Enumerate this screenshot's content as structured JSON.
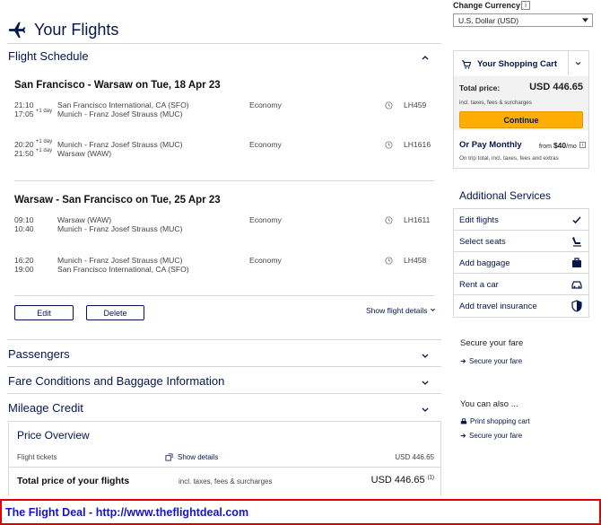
{
  "header": {
    "title": "Your Flights"
  },
  "schedule": {
    "title": "Flight Schedule",
    "routes": [
      {
        "title": "San Francisco - Warsaw on Tue, 18 Apr 23",
        "segments": [
          {
            "dep_time": "21:10",
            "dep_airport": "San Francisco International, CA (SFO)",
            "arr_time": "17:05",
            "arr_day": "+1 day",
            "arr_airport": "Munich - Franz Josef Strauss (MUC)",
            "cabin": "Economy",
            "flight": "LH459"
          },
          {
            "dep_time": "20:20",
            "dep_day": "+1 day",
            "dep_airport": "Munich - Franz Josef Strauss (MUC)",
            "arr_time": "21:50",
            "arr_day": "+1 day",
            "arr_airport": "Warsaw (WAW)",
            "cabin": "Economy",
            "flight": "LH1616"
          }
        ]
      },
      {
        "title": "Warsaw - San Francisco on Tue, 25 Apr 23",
        "segments": [
          {
            "dep_time": "09:10",
            "dep_airport": "Warsaw (WAW)",
            "arr_time": "10:40",
            "arr_airport": "Munich - Franz Josef Strauss (MUC)",
            "cabin": "Economy",
            "flight": "LH1611"
          },
          {
            "dep_time": "16:20",
            "dep_airport": "Munich - Franz Josef Strauss (MUC)",
            "arr_time": "19:00",
            "arr_airport": "San Francisco International, CA (SFO)",
            "cabin": "Economy",
            "flight": "LH458"
          }
        ]
      }
    ],
    "edit_label": "Edit",
    "delete_label": "Delete",
    "show_details": "Show flight details"
  },
  "sections": {
    "passengers": "Passengers",
    "fare_conditions": "Fare Conditions and Baggage Information",
    "mileage": "Mileage Credit"
  },
  "price_overview": {
    "title": "Price Overview",
    "tickets_label": "Flight tickets",
    "show_details": "Show details",
    "tickets_amount": "USD 446.65",
    "total_label": "Total price of your flights",
    "total_note": "incl. taxes, fees & surcharges",
    "total_amount": "USD 446.65",
    "total_footnote": "(1)"
  },
  "currency": {
    "label": "Change Currency:",
    "info": "i",
    "selected": "U.S. Dollar (USD)"
  },
  "cart": {
    "title": "Your Shopping Cart",
    "total_label": "Total price:",
    "total_amount": "USD 446.65",
    "total_note": "incl. taxes, fees & surcharges",
    "continue_label": "Continue",
    "pay_monthly_title": "Or Pay Monthly",
    "pay_from": "from",
    "pay_amount": "$40",
    "pay_unit": "/mo",
    "pay_note": "On trip total, incl. taxes, fees and extras"
  },
  "services": {
    "title": "Additional Services",
    "items": [
      {
        "label": "Edit flights",
        "icon": "check-icon"
      },
      {
        "label": "Select seats",
        "icon": "seat-icon"
      },
      {
        "label": "Add baggage",
        "icon": "baggage-icon"
      },
      {
        "label": "Rent a car",
        "icon": "car-icon"
      },
      {
        "label": "Add travel insurance",
        "icon": "shield-icon"
      }
    ]
  },
  "secure": {
    "title": "Secure your fare",
    "link": "Secure your fare"
  },
  "also": {
    "title": "You can also ...",
    "print": "Print shopping cart",
    "secure": "Secure your fare"
  },
  "banner": {
    "text": "The Flight Deal - http://www.theflightdeal.com"
  },
  "colors": {
    "brand": "#05164d",
    "accent": "#ffad00",
    "banner_border": "#e00000",
    "banner_text": "#1515cc"
  }
}
